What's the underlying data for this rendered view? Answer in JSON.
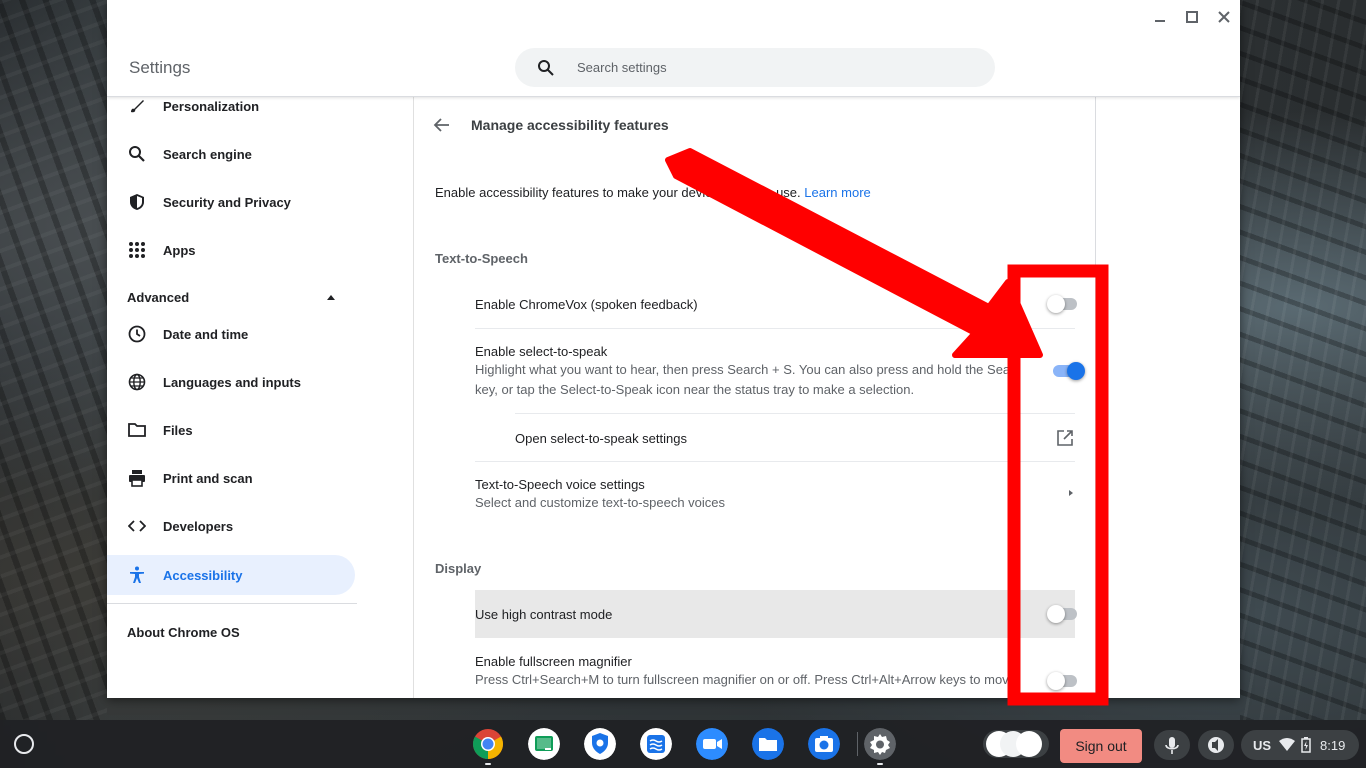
{
  "window": {
    "app_title": "Settings",
    "search_placeholder": "Search settings"
  },
  "sidebar": {
    "items_top": [
      {
        "label": "Personalization",
        "icon": "brush-icon"
      },
      {
        "label": "Search engine",
        "icon": "search-icon"
      },
      {
        "label": "Security and Privacy",
        "icon": "shield-icon"
      },
      {
        "label": "Apps",
        "icon": "apps-grid-icon"
      }
    ],
    "advanced_label": "Advanced",
    "items_advanced": [
      {
        "label": "Date and time",
        "icon": "clock-icon"
      },
      {
        "label": "Languages and inputs",
        "icon": "globe-icon"
      },
      {
        "label": "Files",
        "icon": "folder-icon"
      },
      {
        "label": "Print and scan",
        "icon": "printer-icon"
      },
      {
        "label": "Developers",
        "icon": "code-icon"
      },
      {
        "label": "Accessibility",
        "icon": "accessibility-icon",
        "active": true
      }
    ],
    "about_label": "About Chrome OS"
  },
  "main": {
    "page_title": "Manage accessibility features",
    "intro_text": "Enable accessibility features to make your de",
    "intro_text_hidden": "vice eas",
    "intro_text_end": "ier to use.",
    "learn_more": "Learn more",
    "tts_heading": "Text-to-Speech",
    "chromevox_label": "Enable ChromeVox (spoken feedback)",
    "chromevox_on": false,
    "sts_label": "Enable select-to-speak",
    "sts_desc_1": "Highlight what you want to hear, then press Search + S. You can also press and hold the Search",
    "sts_desc_2": "key, or tap the Select-to-Speak icon near the status tray to make a selection.",
    "sts_on": true,
    "sts_settings_label": "Open select-to-speak settings",
    "tts_voice_label": "Text-to-Speech voice settings",
    "tts_voice_desc": "Select and customize text-to-speech voices",
    "display_heading": "Display",
    "high_contrast_label": "Use high contrast mode",
    "high_contrast_on": false,
    "magnifier_label": "Enable fullscreen magnifier",
    "magnifier_desc": "Press Ctrl+Search+M to turn fullscreen magnifier on or off. Press Ctrl+Alt+Arrow keys to move",
    "magnifier_on": false
  },
  "annotation": {
    "color": "#ff0000"
  },
  "shelf": {
    "apps": [
      {
        "name": "chrome-icon",
        "color": "#4285f4"
      },
      {
        "name": "classroom-icon",
        "color": "#0f9d58"
      },
      {
        "name": "vpn-shield-icon",
        "color": "#1a73e8"
      },
      {
        "name": "app-icon",
        "color": "#1a73e8"
      },
      {
        "name": "zoom-icon",
        "color": "#2d8cff"
      },
      {
        "name": "files-icon",
        "color": "#1a73e8"
      },
      {
        "name": "camera-icon",
        "color": "#1a73e8"
      },
      {
        "name": "settings-icon",
        "color": "#5f6368"
      }
    ],
    "sign_out": "Sign out",
    "ime": "US",
    "time": "8:19"
  }
}
